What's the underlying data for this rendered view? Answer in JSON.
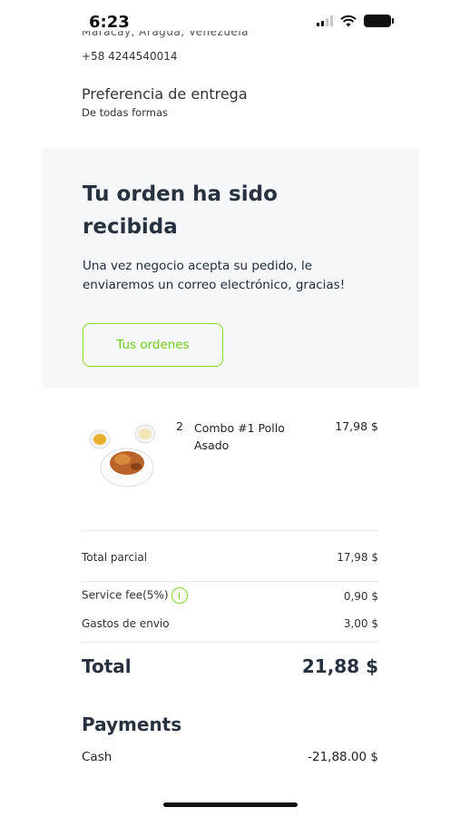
{
  "status_bar": {
    "time": "6:23"
  },
  "address": {
    "partial_line": "Maracay, Aragua, Venezuela",
    "phone": "+58 4244540014"
  },
  "delivery_preference": {
    "title": "Preferencia de entrega",
    "value": "De todas formas"
  },
  "confirmation": {
    "title": "Tu orden ha sido recibida",
    "message": "Una vez negocio acepta su pedido, le enviaremos un correo electrónico, gracias!",
    "orders_button": "Tus ordenes"
  },
  "items": [
    {
      "quantity": "2",
      "name": "Combo #1 Pollo Asado",
      "price": "17,98 $"
    }
  ],
  "summary": {
    "subtotal_label": "Total parcial",
    "subtotal_value": "17,98 $",
    "service_fee_label": "Service fee(5%)",
    "service_fee_value": "0,90 $",
    "shipping_label": "Gastos de envio",
    "shipping_value": "3,00 $",
    "total_label": "Total",
    "total_value": "21,88 $"
  },
  "payments": {
    "title": "Payments",
    "method": "Cash",
    "amount": "-21,88.00 $"
  },
  "colors": {
    "accent": "#86d92b",
    "card_bg": "#f6f7f8",
    "text_dark": "#27313f"
  }
}
